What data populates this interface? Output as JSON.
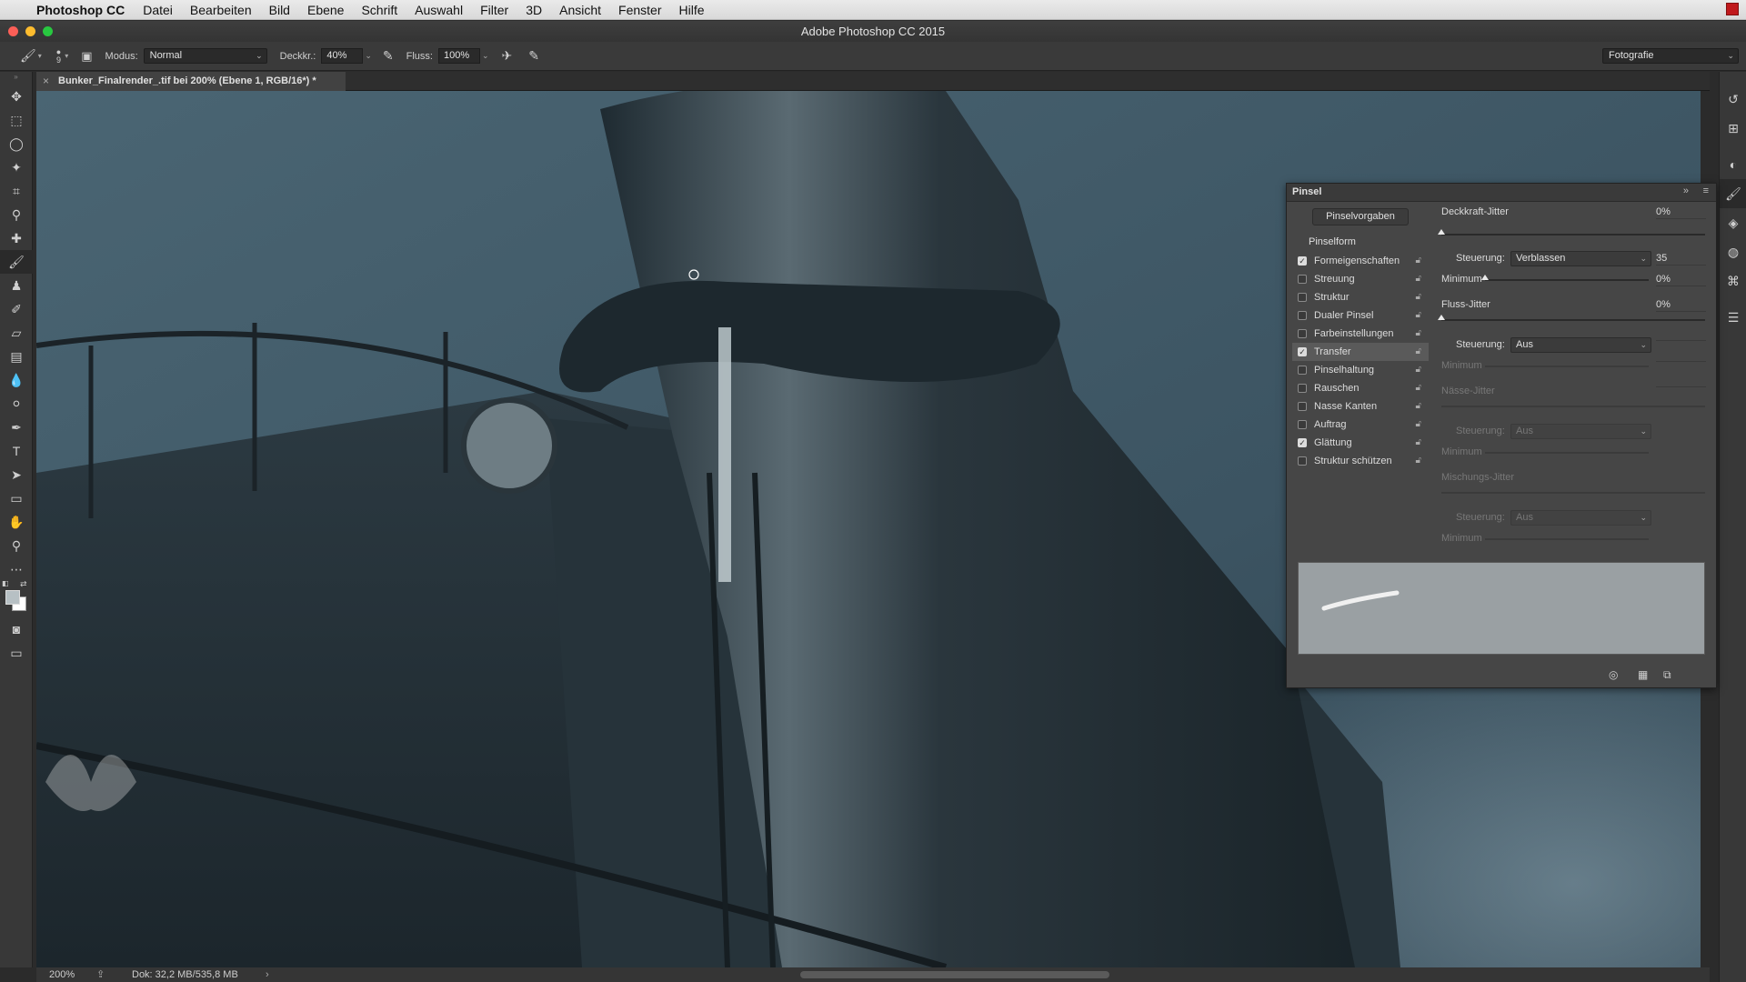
{
  "menubar": {
    "app_name": "Photoshop CC",
    "items": [
      "Datei",
      "Bearbeiten",
      "Bild",
      "Ebene",
      "Schrift",
      "Auswahl",
      "Filter",
      "3D",
      "Ansicht",
      "Fenster",
      "Hilfe"
    ]
  },
  "window": {
    "title": "Adobe Photoshop CC 2015"
  },
  "options": {
    "brush_size": "9",
    "mode_label": "Modus:",
    "mode_value": "Normal",
    "opacity_label": "Deckkr.:",
    "opacity_value": "40%",
    "flow_label": "Fluss:",
    "flow_value": "100%",
    "workspace": "Fotografie"
  },
  "document": {
    "tab_title": "Bunker_Finalrender_.tif bei 200% (Ebene 1, RGB/16*) *"
  },
  "status": {
    "zoom": "200%",
    "doc_size": "Dok: 32,2 MB/535,8 MB"
  },
  "brush_panel": {
    "title": "Pinsel",
    "presets_button": "Pinselvorgaben",
    "brush_tip": "Pinselform",
    "options": [
      {
        "label": "Formeigenschaften",
        "checked": true
      },
      {
        "label": "Streuung",
        "checked": false
      },
      {
        "label": "Struktur",
        "checked": false
      },
      {
        "label": "Dualer Pinsel",
        "checked": false
      },
      {
        "label": "Farbeinstellungen",
        "checked": false
      },
      {
        "label": "Transfer",
        "checked": true
      },
      {
        "label": "Pinselhaltung",
        "checked": false
      },
      {
        "label": "Rauschen",
        "checked": false
      },
      {
        "label": "Nasse Kanten",
        "checked": false
      },
      {
        "label": "Auftrag",
        "checked": false
      },
      {
        "label": "Glättung",
        "checked": true
      },
      {
        "label": "Struktur schützen",
        "checked": false
      }
    ],
    "settings": {
      "opacity_jitter_label": "Deckkraft-Jitter",
      "opacity_jitter_value": "0%",
      "control_label": "Steuerung:",
      "control1_value": "Verblassen",
      "control1_number": "35",
      "minimum_label": "Minimum",
      "minimum1_value": "0%",
      "flow_jitter_label": "Fluss-Jitter",
      "flow_jitter_value": "0%",
      "control2_value": "Aus",
      "wetness_jitter_label": "Nässe-Jitter",
      "control3_value": "Aus",
      "mix_jitter_label": "Mischungs-Jitter",
      "control4_value": "Aus"
    }
  },
  "colors": {
    "foreground": "#b7c0c4",
    "background": "#ffffff",
    "canvas_sky": "#3d5563"
  }
}
